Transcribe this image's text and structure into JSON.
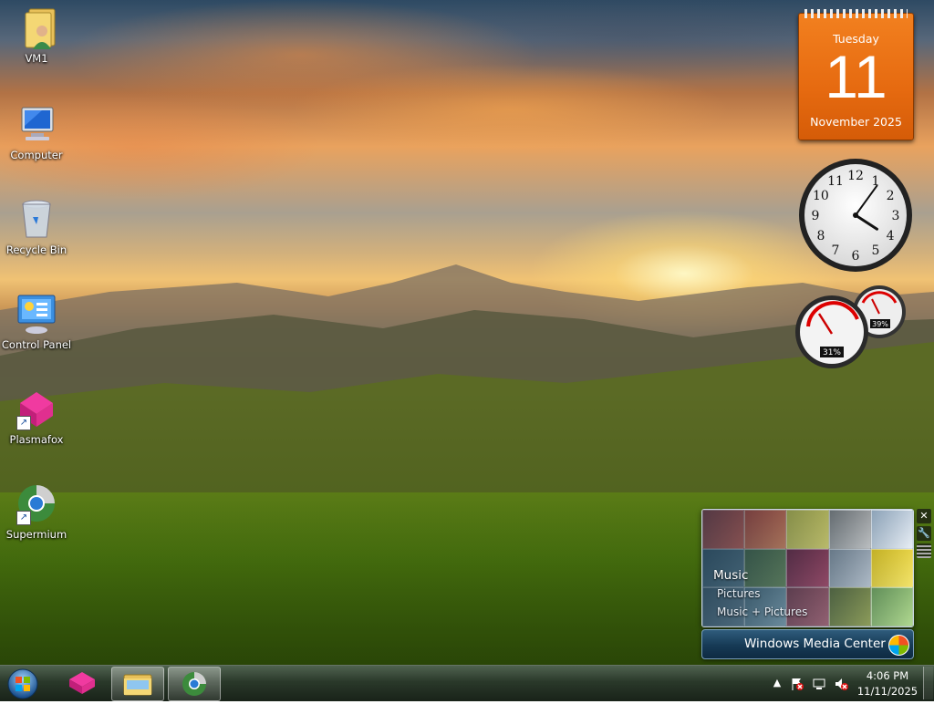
{
  "desktop": {
    "icons": [
      {
        "label": "VM1"
      },
      {
        "label": "Computer"
      },
      {
        "label": "Recycle Bin"
      },
      {
        "label": "Control Panel"
      },
      {
        "label": "Plasmafox"
      },
      {
        "label": "Supermium"
      }
    ]
  },
  "calendar": {
    "weekday": "Tuesday",
    "day": "11",
    "month_year": "November 2025"
  },
  "clock_gadget": {
    "numerals": [
      "12",
      "1",
      "2",
      "3",
      "4",
      "5",
      "6",
      "7",
      "8",
      "9",
      "10",
      "11"
    ],
    "hour": 4,
    "minute": 6
  },
  "cpu_meter": {
    "cpu_percent": "31%",
    "memory_percent": "39%"
  },
  "media_center": {
    "menu": [
      {
        "label": "Music"
      },
      {
        "label": "Pictures"
      },
      {
        "label": "Music + Pictures"
      }
    ],
    "bar_label": "Windows Media Center",
    "controls": {
      "close": "✕",
      "options": "🔧"
    }
  },
  "taskbar": {
    "time": "4:06 PM",
    "date": "11/11/2025",
    "tray_arrow": "▲"
  }
}
